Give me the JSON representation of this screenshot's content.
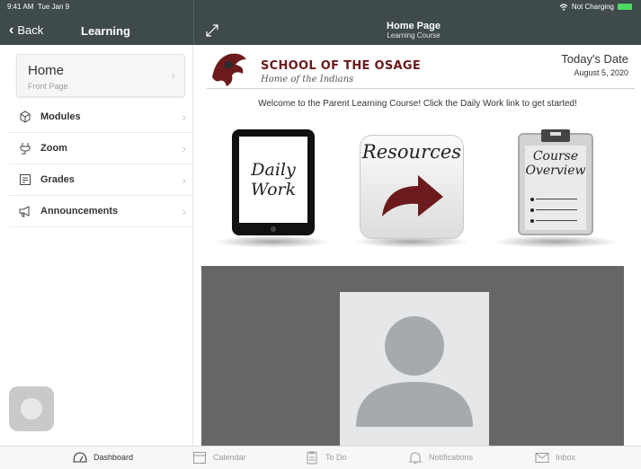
{
  "status": {
    "time": "9:41 AM",
    "date": "Tue Jan 9",
    "charging": "Not Charging"
  },
  "header": {
    "back_label": "Back",
    "left_title": "Learning",
    "page_title": "Home Page",
    "page_subtitle": "Learning Course"
  },
  "sidebar": {
    "home": {
      "label": "Home",
      "sub": "Front Page"
    },
    "items": [
      {
        "label": "Modules",
        "icon": "modules-icon"
      },
      {
        "label": "Zoom",
        "icon": "plug-icon"
      },
      {
        "label": "Grades",
        "icon": "grades-icon"
      },
      {
        "label": "Announcements",
        "icon": "megaphone-icon"
      }
    ]
  },
  "main": {
    "school_name": "SCHOOL OF THE OSAGE",
    "school_tagline": "Home of the Indians",
    "date_label": "Today's Date",
    "date_value": "August 5, 2020",
    "welcome": "Welcome to the Parent Learning Course! Click the Daily Work link to get started!",
    "tiles": {
      "daily_work": "Daily Work",
      "resources": "Resources",
      "course_overview": "Course Overview"
    }
  },
  "tabbar": {
    "items": [
      {
        "label": "Dashboard",
        "active": true
      },
      {
        "label": "Calendar"
      },
      {
        "label": "To Do"
      },
      {
        "label": "Notifications"
      },
      {
        "label": "Inbox"
      }
    ]
  },
  "colors": {
    "header_bg": "#3f4a4b",
    "brand_maroon": "#6b1b1b",
    "video_bg": "#666666"
  }
}
